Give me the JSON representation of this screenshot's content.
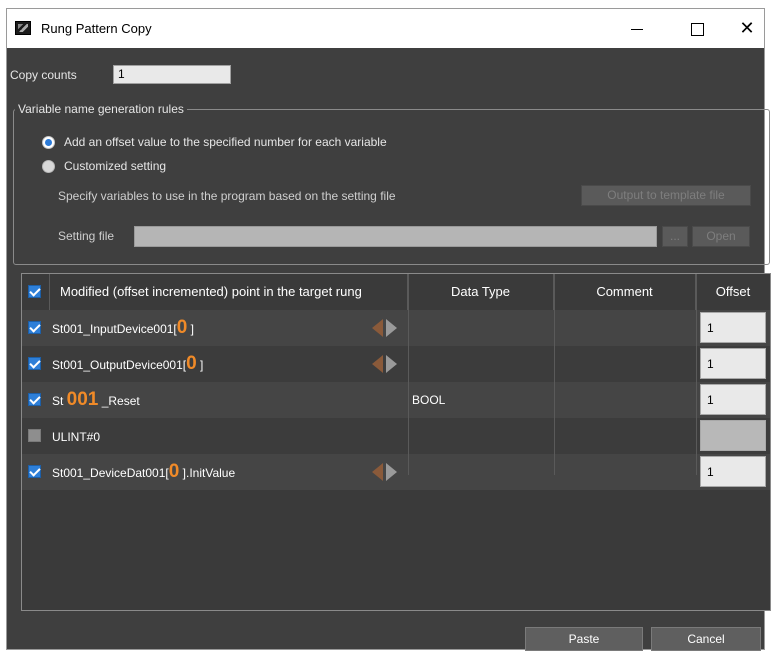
{
  "window": {
    "title": "Rung Pattern Copy"
  },
  "copy_counts": {
    "label": "Copy counts",
    "value": "1"
  },
  "rules": {
    "group_title": "Variable name generation rules",
    "option_offset": "Add an offset value to the specified number for each variable",
    "option_custom": "Customized setting",
    "selected": "option_offset",
    "specify_text": "Specify variables to use in the program based on the setting file",
    "output_template_label": "Output to template file",
    "setting_file_label": "Setting file",
    "setting_file_value": "",
    "browse_label": "...",
    "open_label": "Open"
  },
  "table": {
    "headers": {
      "point": "Modified (offset incremented) point in the target rung",
      "data_type": "Data Type",
      "comment": "Comment",
      "offset": "Offset"
    },
    "rows": [
      {
        "checked": true,
        "prefix": "St001_InputDevice001[",
        "highlight": "0",
        "suffix": " ]",
        "arrows": true,
        "data_type": "",
        "comment": "",
        "offset": "1"
      },
      {
        "checked": true,
        "prefix": "St001_OutputDevice001[",
        "highlight": "0",
        "suffix": " ]",
        "arrows": true,
        "data_type": "",
        "comment": "",
        "offset": "1"
      },
      {
        "checked": true,
        "prefix": "St ",
        "highlight": "001",
        "suffix": " _Reset",
        "arrows": false,
        "data_type": "BOOL",
        "comment": "",
        "offset": "1"
      },
      {
        "checked": false,
        "prefix": "ULINT#0",
        "highlight": "",
        "suffix": "",
        "arrows": false,
        "data_type": "",
        "comment": "",
        "offset": ""
      },
      {
        "checked": true,
        "prefix": "St001_DeviceDat001[",
        "highlight": "0",
        "suffix": " ].InitValue",
        "arrows": true,
        "data_type": "",
        "comment": "",
        "offset": "1"
      }
    ]
  },
  "buttons": {
    "paste": "Paste",
    "cancel": "Cancel"
  },
  "colors": {
    "accent": "#2e7fd8",
    "highlight": "#f08a28",
    "background": "#3f3f3f"
  }
}
